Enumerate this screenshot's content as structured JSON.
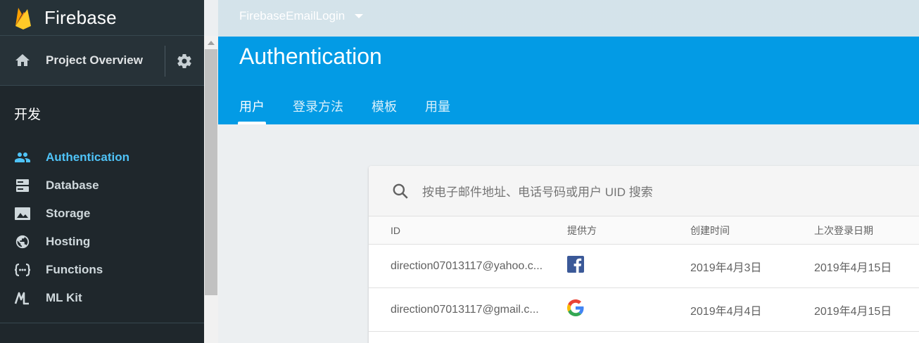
{
  "app": {
    "name": "Firebase",
    "project": "FirebaseEmailLogin"
  },
  "sidebar": {
    "overview_label": "Project Overview",
    "section_title": "开发",
    "items": [
      {
        "label": "Authentication",
        "icon": "people-icon",
        "active": true
      },
      {
        "label": "Database",
        "icon": "database-icon",
        "active": false
      },
      {
        "label": "Storage",
        "icon": "storage-icon",
        "active": false
      },
      {
        "label": "Hosting",
        "icon": "globe-icon",
        "active": false
      },
      {
        "label": "Functions",
        "icon": "functions-icon",
        "active": false
      },
      {
        "label": "ML Kit",
        "icon": "mlkit-icon",
        "active": false
      }
    ]
  },
  "header": {
    "title": "Authentication",
    "tabs": [
      {
        "label": "用户",
        "active": true
      },
      {
        "label": "登录方法",
        "active": false
      },
      {
        "label": "模板",
        "active": false
      },
      {
        "label": "用量",
        "active": false
      }
    ]
  },
  "search": {
    "placeholder": "按电子邮件地址、电话号码或用户 UID 搜索"
  },
  "table": {
    "columns": [
      "ID",
      "提供方",
      "创建时间",
      "上次登录日期"
    ],
    "rows": [
      {
        "id": "direction07013117@yahoo.c...",
        "provider": "facebook-icon",
        "created": "2019年4月3日",
        "last_login": "2019年4月15日"
      },
      {
        "id": "direction07013117@gmail.c...",
        "provider": "google-icon",
        "created": "2019年4月4日",
        "last_login": "2019年4月15日"
      }
    ]
  },
  "colors": {
    "accent": "#039be5",
    "sidebar": "#263238",
    "active_nav": "#4fc3f7"
  }
}
